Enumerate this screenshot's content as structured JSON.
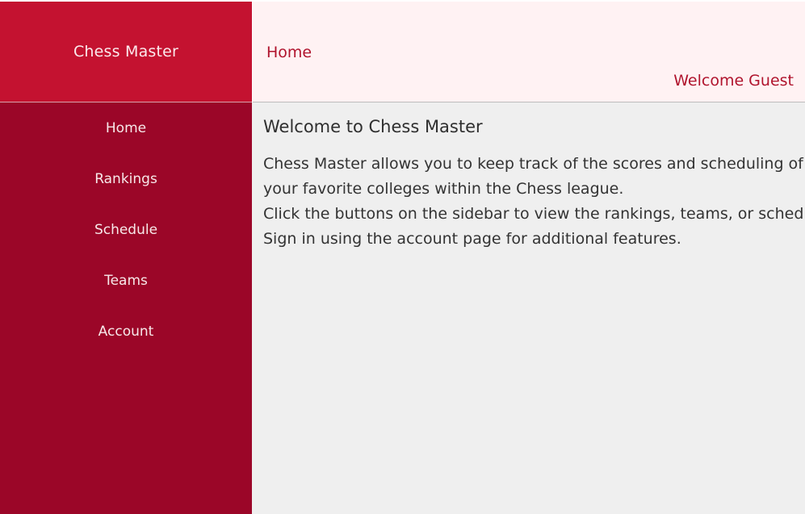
{
  "app": {
    "brand": "Chess Master"
  },
  "header": {
    "page_title": "Home",
    "welcome_text": "Welcome Guest"
  },
  "sidebar": {
    "items": [
      {
        "label": "Home"
      },
      {
        "label": "Rankings"
      },
      {
        "label": "Schedule"
      },
      {
        "label": "Teams"
      },
      {
        "label": "Account"
      }
    ]
  },
  "main": {
    "heading": "Welcome to Chess Master",
    "lines": [
      "Chess Master allows you to keep track of the scores and scheduling of",
      "your favorite colleges within the Chess league.",
      "Click the buttons on the sidebar to view the rankings, teams, or schedule.",
      "Sign in using the account page for additional features."
    ]
  },
  "colors": {
    "brand_red": "#c41230",
    "sidebar_red": "#9b0628",
    "header_bg": "#fff2f3",
    "content_bg": "#efefef",
    "accent_text": "#b0142d"
  }
}
